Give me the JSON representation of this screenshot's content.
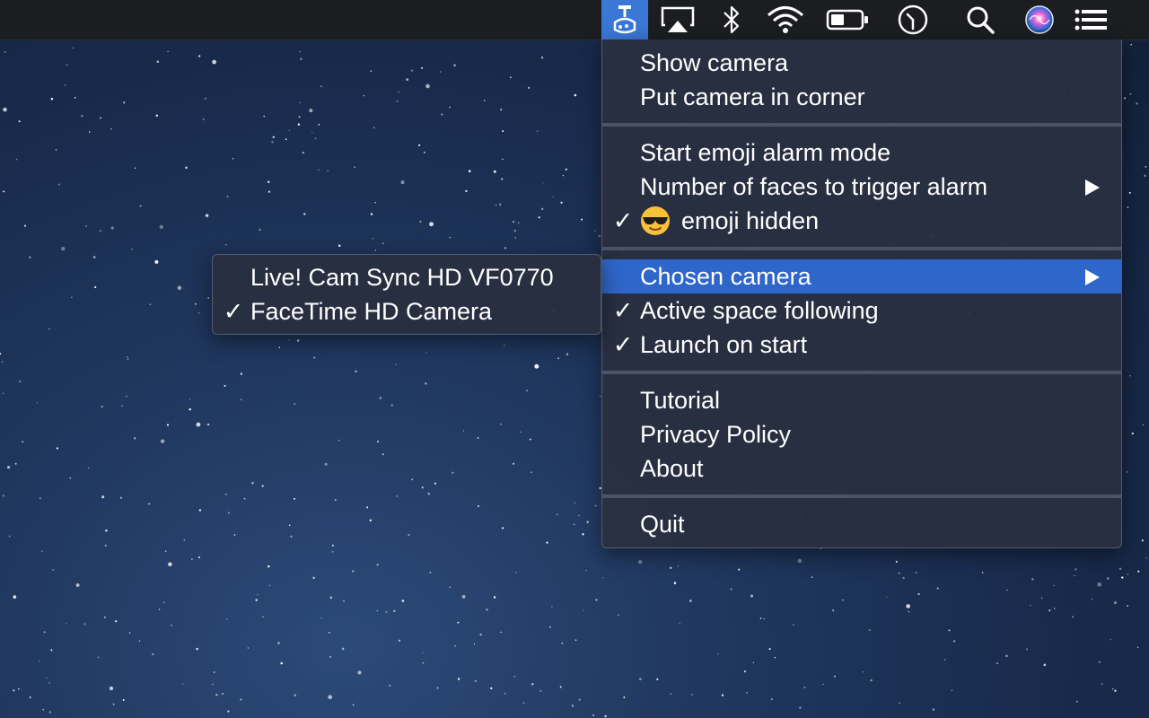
{
  "menubar": {
    "icons": [
      {
        "name": "camera-app-icon",
        "active": true
      },
      {
        "name": "airplay-icon"
      },
      {
        "name": "bluetooth-icon"
      },
      {
        "name": "wifi-icon"
      },
      {
        "name": "battery-icon"
      },
      {
        "name": "clock-icon"
      },
      {
        "name": "spotlight-search-icon"
      },
      {
        "name": "siri-icon"
      },
      {
        "name": "notification-center-icon"
      }
    ]
  },
  "main_menu": {
    "show_camera": "Show camera",
    "put_camera_in_corner": "Put camera in corner",
    "start_emoji_alarm_mode": "Start emoji alarm mode",
    "number_of_faces": "Number of faces to trigger alarm",
    "emoji_hidden": "emoji hidden",
    "emoji_hidden_emoji": "😎",
    "chosen_camera": "Chosen camera",
    "active_space_following": "Active space following",
    "launch_on_start": "Launch on start",
    "tutorial": "Tutorial",
    "privacy_policy": "Privacy Policy",
    "about": "About",
    "quit": "Quit",
    "checkmark": "✓"
  },
  "camera_submenu": {
    "items": [
      {
        "label": "Live! Cam Sync HD VF0770",
        "checked": false
      },
      {
        "label": "FaceTime HD Camera",
        "checked": true
      }
    ]
  },
  "colors": {
    "highlight": "#2f66c9",
    "menubar_active": "#3a77d6",
    "menu_bg": "#283040"
  }
}
